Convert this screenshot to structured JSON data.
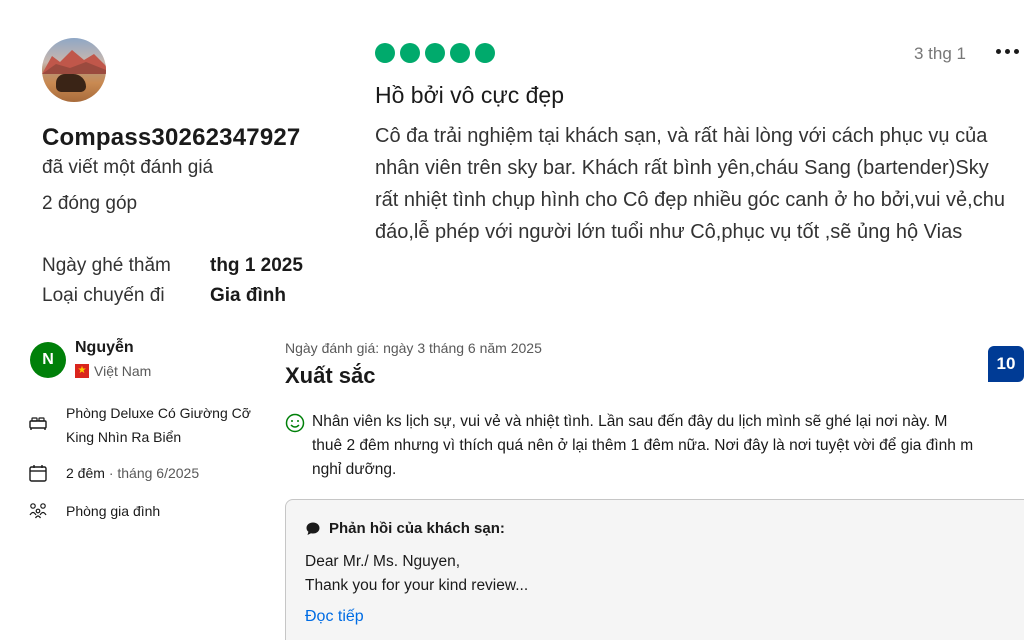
{
  "top_review": {
    "username": "Compass30262347927",
    "wrote_label": "đã viết một đánh giá",
    "contributions": "2 đóng góp",
    "visit_date_label": "Ngày ghé thăm",
    "visit_date_value": "thg 1 2025",
    "trip_type_label": "Loại chuyến đi",
    "trip_type_value": "Gia đình",
    "rating_bubbles": 5,
    "rating_color": "#00aa6c",
    "date": "3 thg 1",
    "more_icon": "more-horizontal-icon",
    "title": "Hồ bởi vô cực đẹp",
    "body": "Cô đa trải nghiệm tại khách sạn, và rất hài lòng với cách phục vụ của nhân viên trên sky bar. Khách rất bình yên,cháu Sang (bartender)Sky rất nhiệt tình chụp hình cho Cô đẹp nhiều góc canh ở ho bởi,vui vẻ,chu đáo,lễ phép với người lớn tuổi như Cô,phục vụ tốt ,sẽ ủng hộ Vias"
  },
  "bottom_review": {
    "avatar_initial": "N",
    "avatar_color": "#008009",
    "name": "Nguyễn",
    "country": "Việt Nam",
    "room": "Phòng Deluxe Có Giường Cỡ King Nhìn Ra Biển",
    "nights": "2 đêm",
    "stay_month": "· tháng 6/2025",
    "traveler_type": "Phòng gia đình",
    "review_date": "Ngày đánh giá: ngày 3 tháng 6 năm 2025",
    "headline": "Xuất sắc",
    "score": "10",
    "score_color": "#003b95",
    "positive_lines": [
      "Nhân viên ks lịch sự, vui vẻ và nhiệt tình. Lần sau đến đây du lịch mình sẽ ghé lại nơi này. M",
      "thuê 2 đêm nhưng vì thích quá nên ở lại thêm 1 đêm nữa. Nơi đây là nơi tuyệt vời để gia đình m",
      "nghỉ dưỡng."
    ],
    "reply": {
      "heading": "Phản hồi của khách sạn:",
      "line1": "Dear Mr./ Ms. Nguyen,",
      "line2": "Thank you for your kind review...",
      "read_more": "Đọc tiếp"
    }
  }
}
